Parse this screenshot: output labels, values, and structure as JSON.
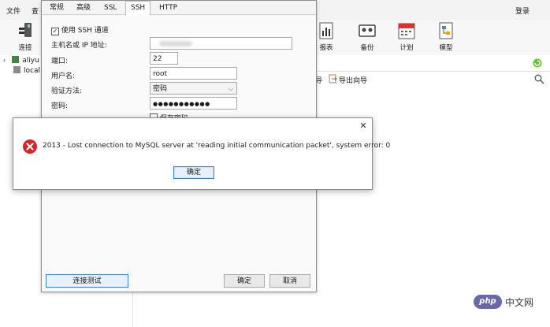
{
  "app": {
    "menu": [
      "文件",
      "查"
    ],
    "login": "登录",
    "toolbar": {
      "connect": "连接",
      "report": "报表",
      "backup": "备份",
      "schedule": "计划",
      "model": "模型"
    },
    "subtoolbar": {
      "import_wizard": "导",
      "export_wizard": "导出向导"
    },
    "tree": [
      "aliyu",
      "local"
    ]
  },
  "conn_dialog": {
    "tabs": [
      "常规",
      "高级",
      "SSL",
      "SSH",
      "HTTP"
    ],
    "active_tab": "SSH",
    "use_ssh": {
      "label": "使用 SSH 通道",
      "checked": true
    },
    "host": {
      "label": "主机名或 IP 地址:",
      "value": ""
    },
    "port": {
      "label": "端口:",
      "value": "22"
    },
    "user": {
      "label": "用户名:",
      "value": "root"
    },
    "auth": {
      "label": "验证方法:",
      "value": "密码"
    },
    "password": {
      "label": "密码:",
      "value": "●●●●●●●●●●●"
    },
    "save_password": "保存密码",
    "test_button": "连接测试",
    "ok_button": "确定",
    "cancel_button": "取消"
  },
  "error_dialog": {
    "message": "2013 - Lost connection to MySQL server at 'reading initial communication packet', system error: 0",
    "ok_button": "确定",
    "close": "✕"
  },
  "watermark": {
    "badge": "php",
    "text": "中文网"
  },
  "colors": {
    "error_red": "#d9222a",
    "focus_blue": "#3c7fd3",
    "watermark_purple": "#6b68a9"
  }
}
